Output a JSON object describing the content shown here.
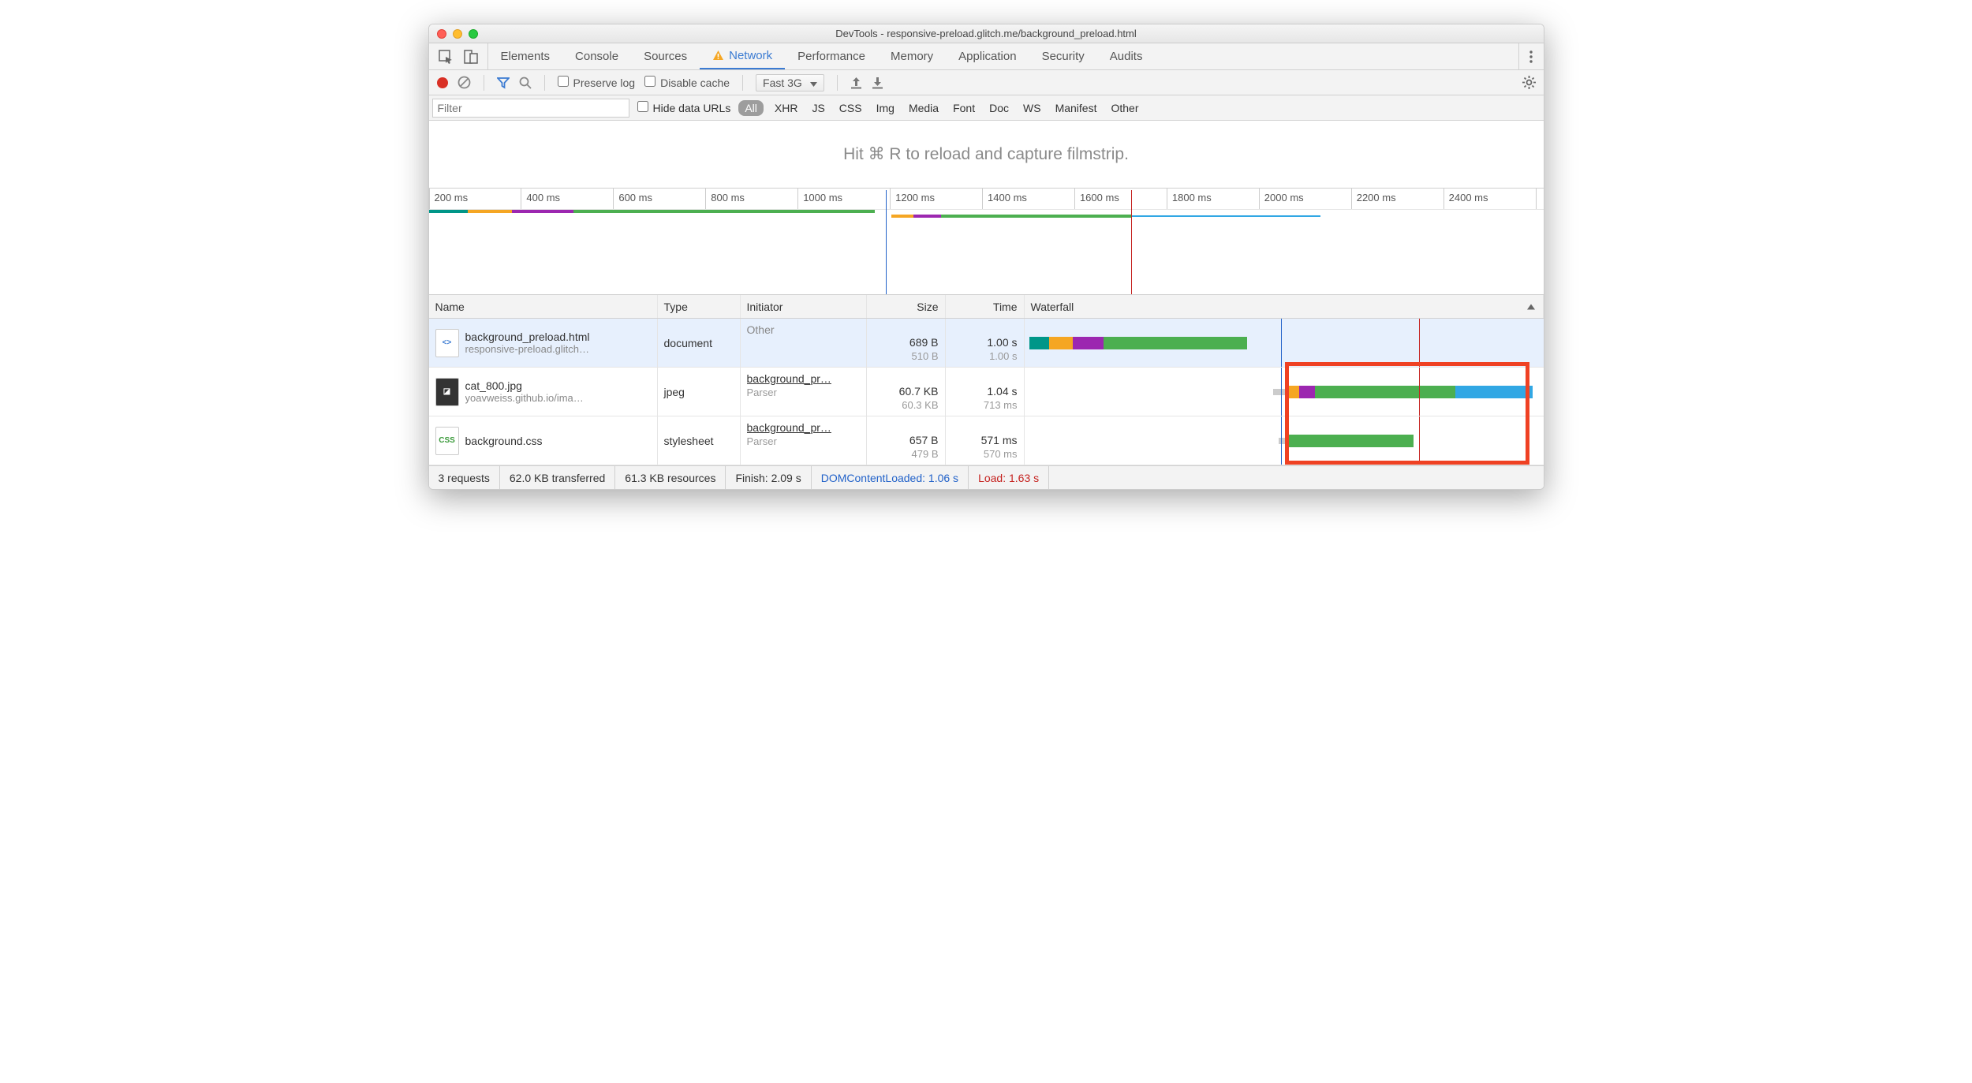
{
  "window": {
    "title": "DevTools - responsive-preload.glitch.me/background_preload.html"
  },
  "mainTabs": [
    "Elements",
    "Console",
    "Sources",
    "Network",
    "Performance",
    "Memory",
    "Application",
    "Security",
    "Audits"
  ],
  "activeTab": "Network",
  "toolbar2": {
    "preserveLog": "Preserve log",
    "disableCache": "Disable cache",
    "throttle": "Fast 3G"
  },
  "filterBar": {
    "placeholder": "Filter",
    "hideDataUrls": "Hide data URLs",
    "types": [
      "All",
      "XHR",
      "JS",
      "CSS",
      "Img",
      "Media",
      "Font",
      "Doc",
      "WS",
      "Manifest",
      "Other"
    ]
  },
  "filmstripHint": "Hit ⌘ R to reload and capture filmstrip.",
  "timeline": {
    "ticks": [
      "200 ms",
      "400 ms",
      "600 ms",
      "800 ms",
      "1000 ms",
      "1200 ms",
      "1400 ms",
      "1600 ms",
      "1800 ms",
      "2000 ms",
      "2200 ms",
      "2400 ms"
    ]
  },
  "columns": [
    "Name",
    "Type",
    "Initiator",
    "Size",
    "Time",
    "Waterfall"
  ],
  "rows": [
    {
      "name": "background_preload.html",
      "sub": "responsive-preload.glitch…",
      "type": "document",
      "init": "Other",
      "initsub": "",
      "size": "689 B",
      "sizesub": "510 B",
      "time": "1.00 s",
      "timesub": "1.00 s"
    },
    {
      "name": "cat_800.jpg",
      "sub": "yoavweiss.github.io/ima…",
      "type": "jpeg",
      "init": "background_pr…",
      "initsub": "Parser",
      "size": "60.7 KB",
      "sizesub": "60.3 KB",
      "time": "1.04 s",
      "timesub": "713 ms"
    },
    {
      "name": "background.css",
      "sub": "",
      "type": "stylesheet",
      "init": "background_pr…",
      "initsub": "Parser",
      "size": "657 B",
      "sizesub": "479 B",
      "time": "571 ms",
      "timesub": "570 ms"
    }
  ],
  "status": {
    "requests": "3 requests",
    "transferred": "62.0 KB transferred",
    "resources": "61.3 KB resources",
    "finish": "Finish: 2.09 s",
    "dcl": "DOMContentLoaded: 1.06 s",
    "load": "Load: 1.63 s"
  }
}
